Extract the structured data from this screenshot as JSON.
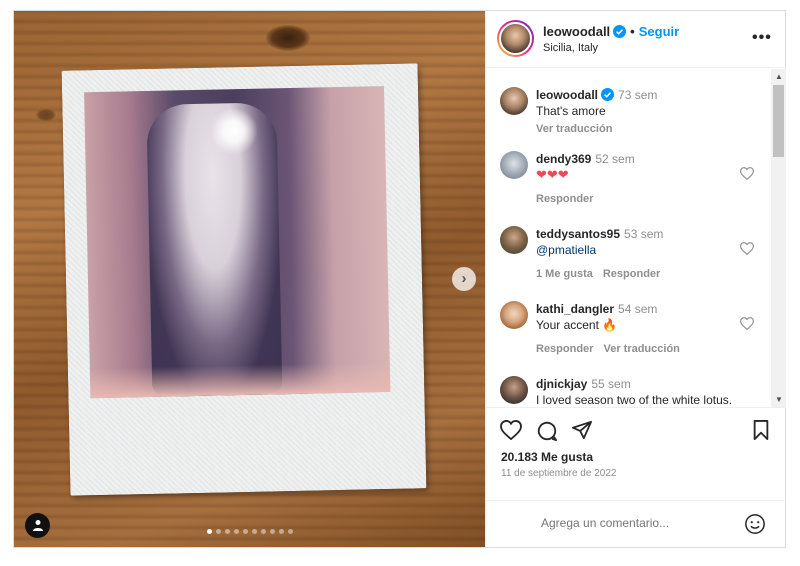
{
  "post": {
    "username": "leowoodall",
    "follow_label": "Seguir",
    "location": "Sicilia, Italy",
    "more_label": "•••",
    "photo_dots": 10,
    "photo_active_dot": 0
  },
  "comments": [
    {
      "user": "leowoodall",
      "time": "73 sem",
      "text": "That's amore",
      "actions": [
        "Ver traducción"
      ],
      "verified": true,
      "heart": false
    },
    {
      "user": "dendy369",
      "time": "52 sem",
      "text": "❤❤❤",
      "actions": [
        "Responder"
      ],
      "verified": false,
      "heart": true
    },
    {
      "user": "teddysantos95",
      "time": "53 sem",
      "text": "@pmatiella",
      "actions": [
        "1 Me gusta",
        "Responder"
      ],
      "verified": false,
      "heart": true
    },
    {
      "user": "kathi_dangler",
      "time": "54 sem",
      "text": "Your accent 🔥",
      "actions": [
        "Responder",
        "Ver traducción"
      ],
      "verified": false,
      "heart": true
    },
    {
      "user": "djnickjay",
      "time": "55 sem",
      "text": "I loved season two of the white lotus. You were great! What a",
      "actions": [],
      "verified": false,
      "heart": false
    }
  ],
  "footer": {
    "likes": "20.183 Me gusta",
    "date": "11 de septiembre de 2022",
    "comment_placeholder": "Agrega un comentario..."
  },
  "colors": {
    "accent": "#0095f6",
    "heart_red": "#ed4956",
    "muted": "#8e8e8e"
  }
}
